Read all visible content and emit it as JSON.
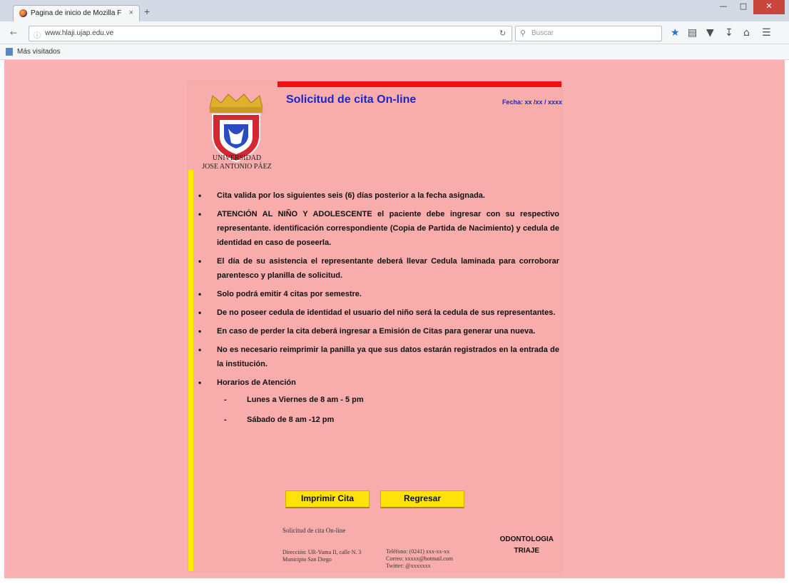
{
  "browser": {
    "tab_title": "Pagina de inicio de Mozilla F",
    "tab_close": "×",
    "new_tab": "+",
    "url": "www.hlaji.ujap.edu.ve",
    "search_placeholder": "Buscar",
    "bookmarks_label": "Más visitados"
  },
  "doc": {
    "title": "Solicitud de cita On-line",
    "date": "Fecha: xx /xx / xxxx",
    "university_line1": "UNIVERSIDAD",
    "university_line2": "JOSE ANTONIO PÁEZ",
    "rules": [
      "Cita valida por los siguientes seis (6) días posterior a la fecha asignada.",
      "ATENCIÓN AL NIÑO Y ADOLESCENTE el paciente debe ingresar con su respectivo representante. identificación correspondiente (Copia de Partida de Nacimiento) y cedula de identidad en caso de poseerla.",
      "El día de su asistencia el representante deberá llevar Cedula laminada para corroborar parentesco y planilla de solicitud.",
      "Solo podrá emitir 4 citas por semestre.",
      "De no poseer cedula de identidad el usuario del niño será la cedula de sus representantes.",
      "En caso de perder la cita deberá ingresar a Emisión de Citas para generar una nueva.",
      "No es necesario reimprimir la panilla ya que sus datos estarán registrados en la entrada de la institución."
    ],
    "hours_title": "Horarios de Atención",
    "hours": [
      "Lunes a Viernes de 8 am - 5 pm",
      "Sábado de 8 am -12 pm"
    ],
    "print_button": "Imprimir Cita",
    "back_button": "Regresar",
    "footer": {
      "title": "Solicitud de cita On-line",
      "address_line1": "Dirección: UR-Yuma II, calle N. 3",
      "address_line2": "Municipio San Diego",
      "phone": "Teléfono: (0241) xxx-xx-xx",
      "email": "Correo: xxxxx@hotmail.com",
      "twitter": "Twitter: @xxxxxxx",
      "dept_line1": "ODONTOLOGIA",
      "dept_line2": "TRIAJE"
    }
  },
  "colors": {
    "page_bg": "#f9b1b1",
    "accent_red": "#ee1111",
    "accent_yellow": "#ffeb00",
    "title_blue": "#1a28c8",
    "button_yellow": "#ffe20a"
  }
}
